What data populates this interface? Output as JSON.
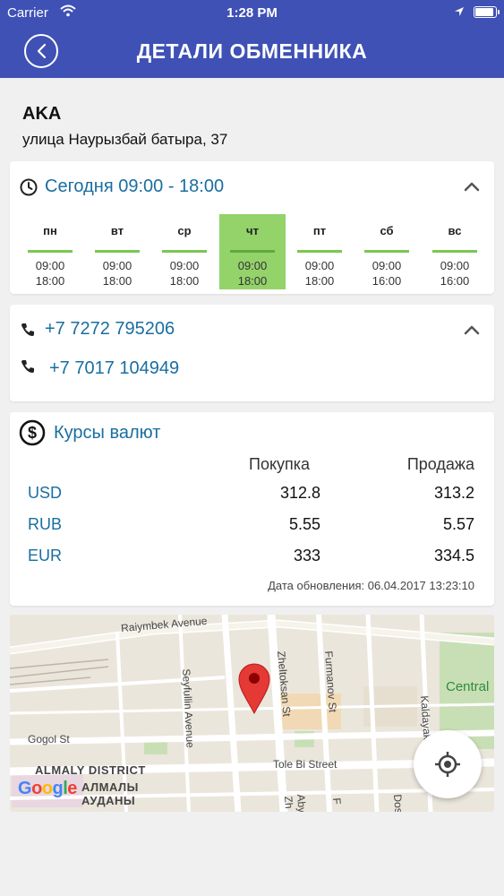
{
  "status": {
    "carrier": "Carrier",
    "time": "1:28 PM",
    "battery_level": 0.95
  },
  "nav": {
    "title": "ДЕТАЛИ ОБМЕННИКА"
  },
  "exchange": {
    "name": "AKA",
    "address": "улица Наурызбай батыра, 37"
  },
  "schedule": {
    "today": "Сегодня 09:00 - 18:00",
    "days": [
      {
        "name": "пн",
        "open": "09:00",
        "close": "18:00",
        "active": false
      },
      {
        "name": "вт",
        "open": "09:00",
        "close": "18:00",
        "active": false
      },
      {
        "name": "ср",
        "open": "09:00",
        "close": "18:00",
        "active": false
      },
      {
        "name": "чт",
        "open": "09:00",
        "close": "18:00",
        "active": true
      },
      {
        "name": "пт",
        "open": "09:00",
        "close": "18:00",
        "active": false
      },
      {
        "name": "сб",
        "open": "09:00",
        "close": "16:00",
        "active": false
      },
      {
        "name": "вс",
        "open": "09:00",
        "close": "16:00",
        "active": false
      }
    ]
  },
  "phones": [
    "+7 7272 795206",
    "+7 7017 104949"
  ],
  "rates": {
    "title": "Курсы валют",
    "buy_header": "Покупка",
    "sell_header": "Продажа",
    "rows": [
      {
        "currency": "USD",
        "buy": "312.8",
        "sell": "313.2"
      },
      {
        "currency": "RUB",
        "buy": "5.55",
        "sell": "5.57"
      },
      {
        "currency": "EUR",
        "buy": "333",
        "sell": "334.5"
      }
    ],
    "updated": "Дата обновления: 06.04.2017 13:23:10"
  },
  "map": {
    "streets": [
      "Raiymbek Avenue",
      "Seyfullin Avenue",
      "Zheltoksan St",
      "Furmanov St",
      "Kaldayakov",
      "Gogol St",
      "Tole Bi Street",
      "Aby",
      "Zh",
      "F",
      "Dos"
    ],
    "district": "ALMALY DISTRICT",
    "district_local_1": "АЛМАЛЫ",
    "district_local_2": "АУДАНЫ",
    "central": "Central",
    "logo": "Google"
  },
  "colors": {
    "header": "#3f51b5",
    "accent": "#1a6ea0",
    "active_day": "#93d36a",
    "bar": "#7cc653"
  }
}
